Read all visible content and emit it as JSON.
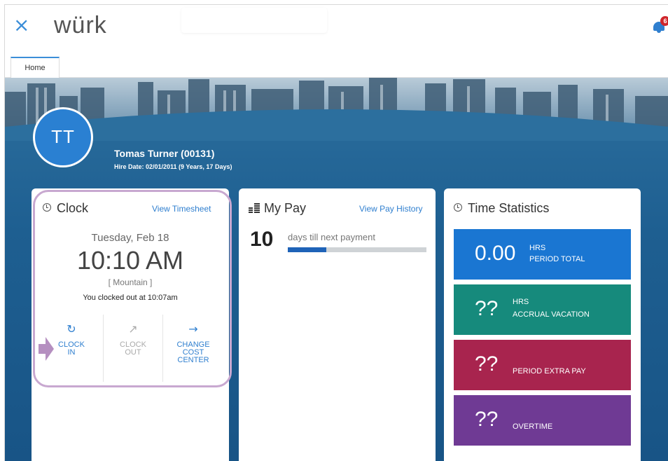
{
  "header": {
    "close_glyph": "×",
    "logo_text": "würk",
    "notification_count": "6"
  },
  "tabs": [
    {
      "label": "Home"
    }
  ],
  "profile": {
    "initials": "TT",
    "name": "Tomas Turner (00131)",
    "hire_date": "Hire Date: 02/01/2011 (9 Years, 17 Days)"
  },
  "clock_card": {
    "title": "Clock",
    "link": "View Timesheet",
    "date": "Tuesday, Feb 18",
    "time": "10:10 AM",
    "timezone": "[ Mountain ]",
    "status": "You clocked out at 10:07am",
    "actions": [
      {
        "label": "CLOCK\nIN",
        "icon": "clock-in-icon",
        "enabled": true
      },
      {
        "label": "CLOCK\nOUT",
        "icon": "clock-out-icon",
        "enabled": false
      },
      {
        "label": "CHANGE\nCOST\nCENTER",
        "icon": "arrow-right-icon",
        "enabled": true
      }
    ]
  },
  "pay_card": {
    "title": "My Pay",
    "link": "View Pay History",
    "days_value": "10",
    "days_label": "days till next payment",
    "progress_fraction": 0.28
  },
  "stats_card": {
    "title": "Time Statistics",
    "tiles": [
      {
        "value": "0.00",
        "unit": "HRS",
        "label": "PERIOD TOTAL",
        "color": "#1a76d2"
      },
      {
        "value": "??",
        "unit": "HRS",
        "label": "ACCRUAL VACATION",
        "color": "#168a7c"
      },
      {
        "value": "??",
        "unit": "",
        "label": "PERIOD EXTRA PAY",
        "color": "#a8244e"
      },
      {
        "value": "??",
        "unit": "",
        "label": "OVERTIME",
        "color": "#6f3a94"
      }
    ]
  },
  "colors": {
    "accent": "#2f7fcf",
    "banner": "#1e5f91",
    "highlight": "#c8a8d0"
  }
}
